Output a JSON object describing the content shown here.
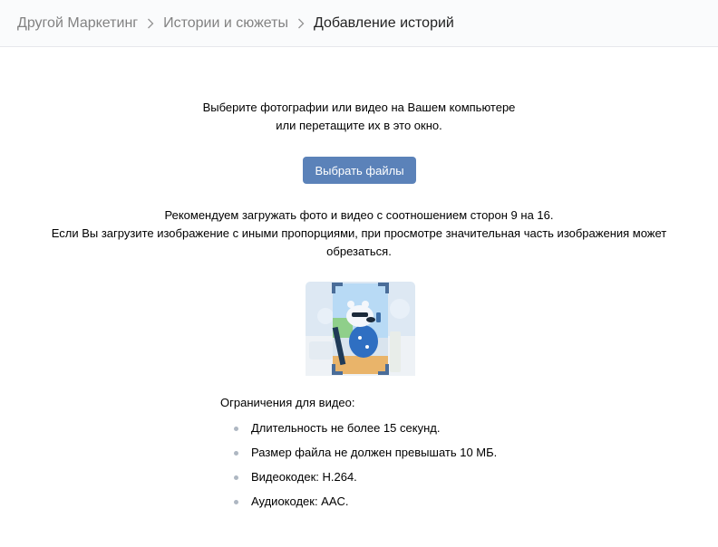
{
  "breadcrumb": {
    "items": [
      {
        "label": "Другой Маркетинг"
      },
      {
        "label": "Истории и сюжеты"
      },
      {
        "label": "Добавление историй"
      }
    ]
  },
  "upload": {
    "instruction_line1": "Выберите фотографии или видео на Вашем компьютере",
    "instruction_line2": "или перетащите их в это окно.",
    "button_label": "Выбрать файлы"
  },
  "recommendation": {
    "line1": "Рекомендуем загружать фото и видео с соотношением сторон 9 на 16.",
    "line2": "Если Вы загрузите изображение с иными пропорциями, при просмотре значительная часть изображения может",
    "line3": "обрезаться."
  },
  "video_limits": {
    "title": "Ограничения для видео:",
    "items": [
      "Длительность не более 15 секунд.",
      "Размер файла не должен превышать 10 МБ.",
      "Видеокодек: H.264.",
      "Аудиокодек: AAC."
    ]
  },
  "colors": {
    "button_bg": "#5b82b9",
    "crumb_inactive": "#828282",
    "crumb_active": "#222222",
    "bullet": "#aeb7c2",
    "crop_frame": "#4a6d99"
  },
  "icons": {
    "separator": "chevron-right-icon",
    "illustration": "story-crop-illustration"
  }
}
